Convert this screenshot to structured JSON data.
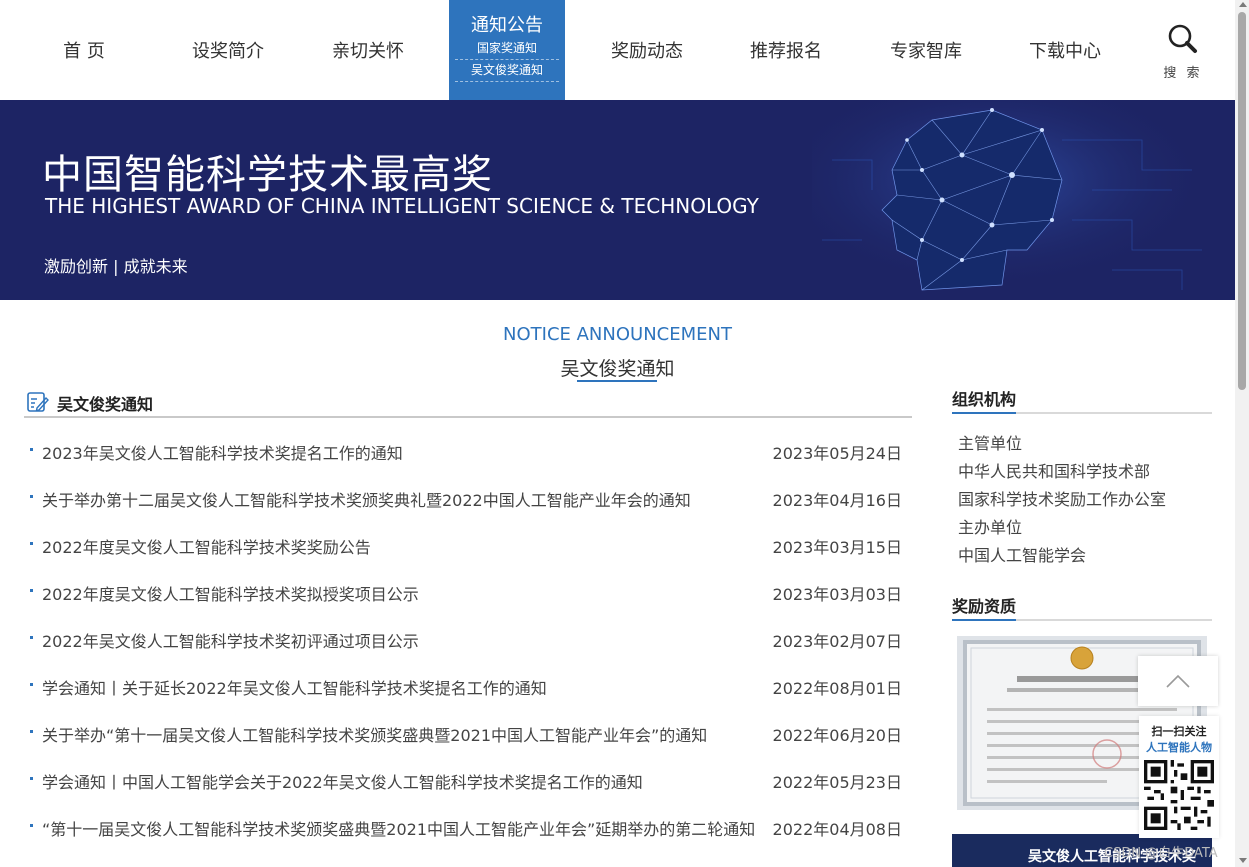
{
  "nav": {
    "items": [
      {
        "label": "首 页"
      },
      {
        "label": "设奖简介"
      },
      {
        "label": "亲切关怀"
      },
      {
        "label": "奖励动态"
      },
      {
        "label": "推荐报名"
      },
      {
        "label": "专家智库"
      },
      {
        "label": "下载中心"
      }
    ],
    "active": {
      "label": "通知公告",
      "sub": [
        "国家奖通知",
        "吴文俊奖通知"
      ]
    },
    "search_label": "搜 索",
    "search_icon": "magnifier-icon"
  },
  "banner": {
    "title_cn": "中国智能科学技术最高奖",
    "title_en": "THE HIGHEST AWARD OF CHINA INTELLIGENT SCIENCE & TECHNOLOGY",
    "slogan": "激励创新 | 成就未来"
  },
  "section": {
    "title_en": "NOTICE ANNOUNCEMENT",
    "title_cn": "吴文俊奖通知"
  },
  "list": {
    "title": "吴文俊奖通知",
    "items": [
      {
        "title": "2023年吴文俊人工智能科学技术奖提名工作的通知",
        "date": "2023年05月24日"
      },
      {
        "title": "关于举办第十二届吴文俊人工智能科学技术奖颁奖典礼暨2022中国人工智能产业年会的通知",
        "date": "2023年04月16日"
      },
      {
        "title": "2022年度吴文俊人工智能科学技术奖奖励公告",
        "date": "2023年03月15日"
      },
      {
        "title": "2022年度吴文俊人工智能科学技术奖拟授奖项目公示",
        "date": "2023年03月03日"
      },
      {
        "title": "2022年吴文俊人工智能科学技术奖初评通过项目公示",
        "date": "2023年02月07日"
      },
      {
        "title": "学会通知丨关于延长2022年吴文俊人工智能科学技术奖提名工作的通知",
        "date": "2022年08月01日"
      },
      {
        "title": "关于举办“第十一届吴文俊人工智能科学技术奖颁奖盛典暨2021中国人工智能产业年会”的通知",
        "date": "2022年06月20日"
      },
      {
        "title": "学会通知丨中国人工智能学会关于2022年吴文俊人工智能科学技术奖提名工作的通知",
        "date": "2022年05月23日"
      },
      {
        "title": "“第十一届吴文俊人工智能科学技术奖颁奖盛典暨2021中国人工智能产业年会”延期举办的第二轮通知",
        "date": "2022年04月08日"
      }
    ]
  },
  "sidebar": {
    "org_title": "组织机构",
    "org_items": [
      "主管单位",
      "中华人民共和国科学技术部",
      "国家科学技术奖励工作办公室",
      "主办单位",
      "中国人工智能学会"
    ],
    "qual_title": "奖励资质",
    "promo_text": "吴文俊人工智能科学技术奖"
  },
  "float": {
    "qr_line1": "扫一扫关注",
    "qr_line2": "人工智能人物",
    "to_top_icon": "chevron-up-icon"
  },
  "watermark": "CSDN @白牛DATA",
  "colors": {
    "accent": "#2e74bd",
    "banner_bg": "#1d2464"
  }
}
